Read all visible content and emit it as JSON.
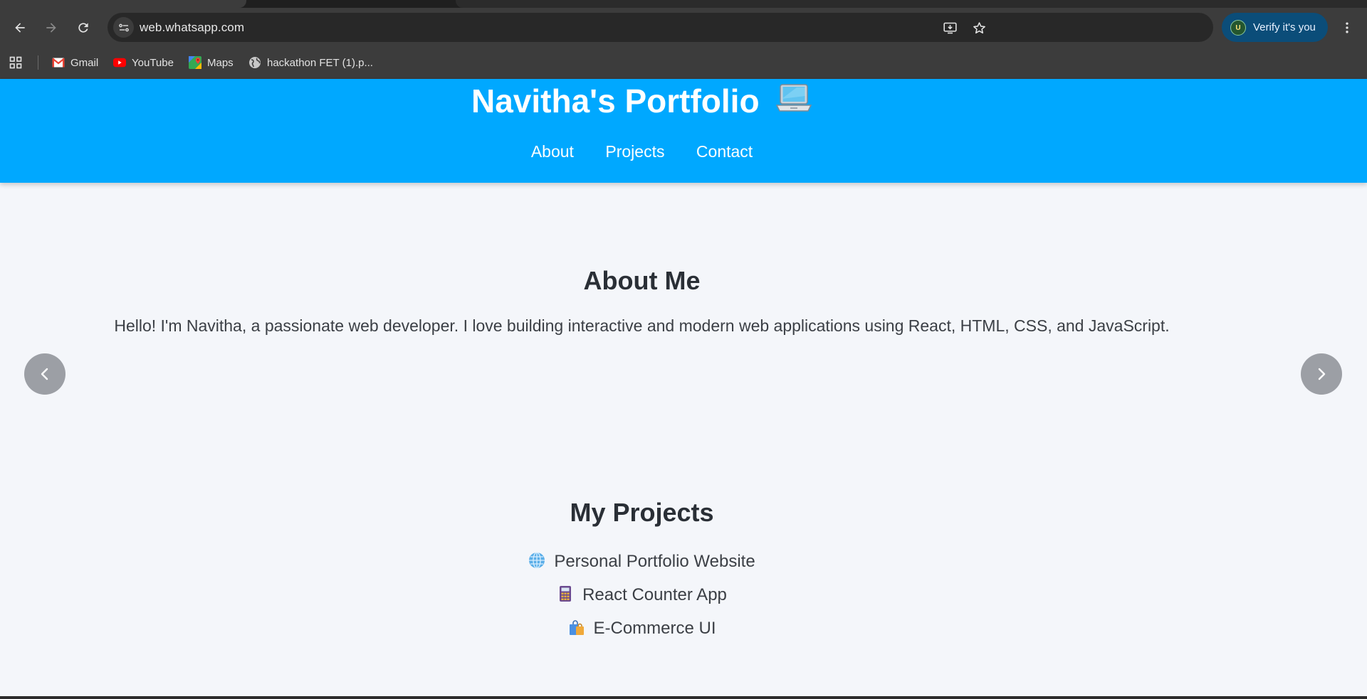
{
  "browser": {
    "url": "web.whatsapp.com",
    "verify_label": "Verify it's you",
    "avatar_initial": "U",
    "bookmarks": [
      {
        "label": "Gmail",
        "icon": "gmail-icon"
      },
      {
        "label": "YouTube",
        "icon": "youtube-icon"
      },
      {
        "label": "Maps",
        "icon": "maps-icon"
      },
      {
        "label": "hackathon  FET (1).p...",
        "icon": "globe-icon"
      }
    ]
  },
  "header": {
    "title": "Navitha's Portfolio",
    "title_icon": "laptop-icon",
    "nav": [
      "About",
      "Projects",
      "Contact"
    ],
    "background": "#00a8ff"
  },
  "about": {
    "heading": "About Me",
    "text": "Hello! I'm Navitha, a passionate web developer. I love building interactive and modern web applications using React, HTML, CSS, and JavaScript."
  },
  "carousel": {
    "prev_icon": "chevron-left-icon",
    "next_icon": "chevron-right-icon"
  },
  "projects": {
    "heading": "My Projects",
    "items": [
      {
        "label": "Personal Portfolio Website",
        "icon": "globe-emoji-icon"
      },
      {
        "label": "React Counter App",
        "icon": "calculator-emoji-icon"
      },
      {
        "label": "E-Commerce UI",
        "icon": "shopping-bags-emoji-icon"
      }
    ]
  }
}
